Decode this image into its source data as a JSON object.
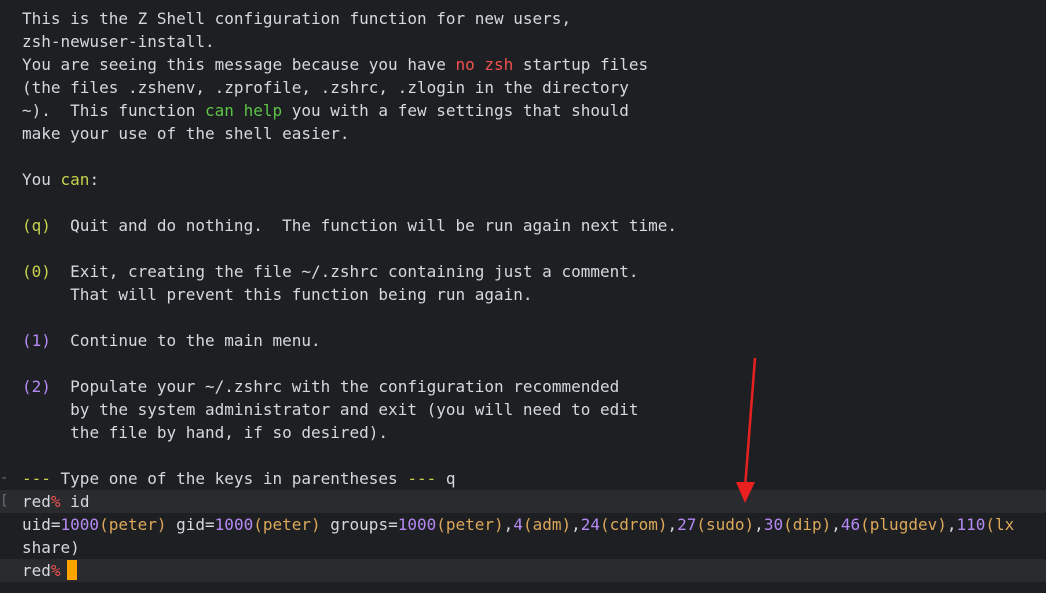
{
  "intro": {
    "l1": "This is the Z Shell configuration function for new users,",
    "l2": "zsh-newuser-install.",
    "l3_a": "You are seeing this message because you have ",
    "l3_red": "no zsh",
    "l3_b": " startup files",
    "l4": "(the files .zshenv, .zprofile, .zshrc, .zlogin in the directory",
    "l5_a": "~).  This function ",
    "l5_green": "can help",
    "l5_b": " you with a few settings that should",
    "l6": "make your use of the shell easier."
  },
  "you_can": {
    "a": "You ",
    "green": "can",
    "b": ":"
  },
  "options": [
    {
      "key": "(q)",
      "lines": [
        "Quit and do nothing.  The function will be run again next time."
      ]
    },
    {
      "key": "(0)",
      "lines": [
        "Exit, creating the file ~/.zshrc containing just a comment.",
        "That will prevent this function being run again."
      ]
    },
    {
      "key": "(1)",
      "lines": [
        "Continue to the main menu."
      ]
    },
    {
      "key": "(2)",
      "lines": [
        "Populate your ~/.zshrc with the configuration recommended",
        "by the system administrator and exit (you will need to edit",
        "the file by hand, if so desired)."
      ]
    }
  ],
  "prompt_line": {
    "dashes1": "---",
    "text": " Type one of the keys in parentheses ",
    "dashes2": "---",
    "answer": " q"
  },
  "cmd1": {
    "host": "red",
    "sym": "%",
    "command": " id"
  },
  "id_output": {
    "p1": "uid=",
    "uid": "1000",
    "uname": "(peter)",
    "p2": " gid=",
    "gid": "1000",
    "gname": "(peter)",
    "p3": " groups=",
    "g1": "1000",
    "g1n": "(peter)",
    "g2": "4",
    "g2n": "(adm)",
    "g3": "24",
    "g3n": "(cdrom)",
    "g4": "27",
    "g4n": "(sudo)",
    "g5": "30",
    "g5n": "(dip)",
    "g6": "46",
    "g6n": "(plugdev)",
    "g7": "110",
    "g7n": "(lx",
    "wrap": "share)"
  },
  "cmd2": {
    "host": "red",
    "sym": "%"
  },
  "colors": {
    "background": "#1e1f22",
    "text": "#d6d8de",
    "red": "#f0524f",
    "green": "#5cc448",
    "yellow_green": "#c7d14c",
    "purple": "#b58af5",
    "cursor": "#ffa500",
    "annotation_arrow": "#e8201f"
  }
}
